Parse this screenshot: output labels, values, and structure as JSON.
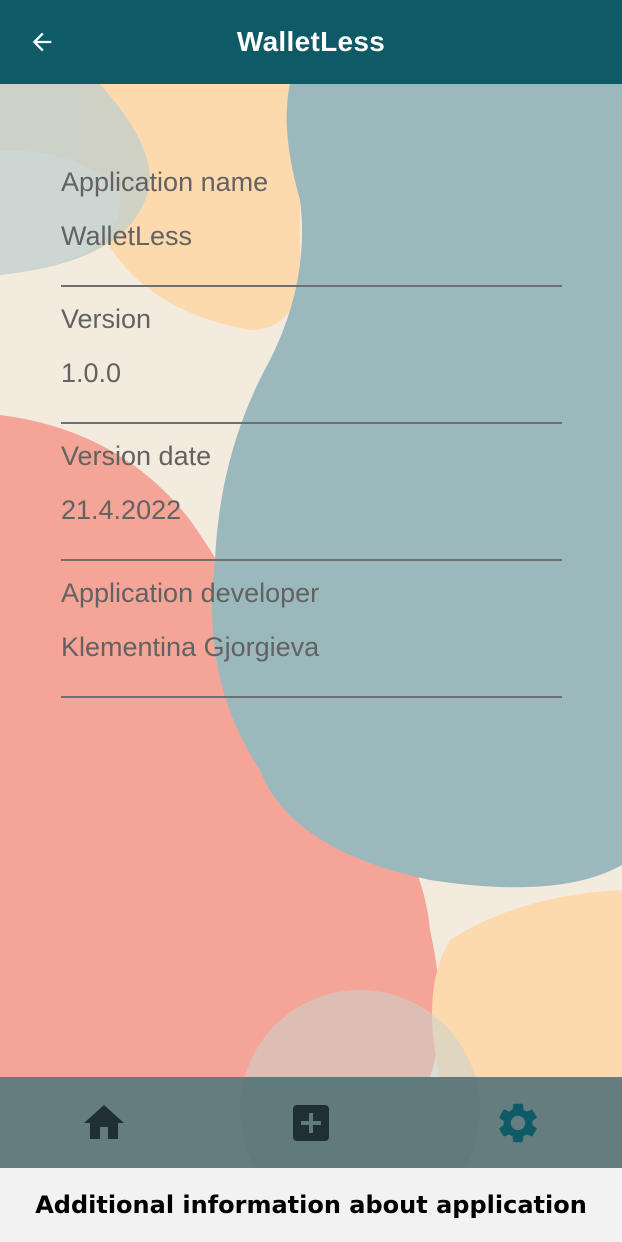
{
  "app_bar": {
    "title": "WalletLess",
    "back_icon": "arrow-left-icon"
  },
  "info": [
    {
      "label": "Application name",
      "value": "WalletLess"
    },
    {
      "label": "Version",
      "value": "1.0.0"
    },
    {
      "label": "Version date",
      "value": "21.4.2022"
    },
    {
      "label": "Application developer",
      "value": "Klementina Gjorgieva"
    }
  ],
  "bottom_nav": {
    "items": [
      {
        "icon": "home-icon",
        "color": "#1f2f33"
      },
      {
        "icon": "add-box-icon",
        "color": "#1f2f33"
      },
      {
        "icon": "gear-icon",
        "color": "#0e5a66",
        "active": true
      }
    ]
  },
  "caption": "Additional information about application",
  "colors": {
    "primary": "#0e5a66",
    "background": "#f4ebdf",
    "blob_teal": "#9bb9bc",
    "blob_coral": "#f5a597",
    "blob_peach": "#fdd9ae"
  }
}
